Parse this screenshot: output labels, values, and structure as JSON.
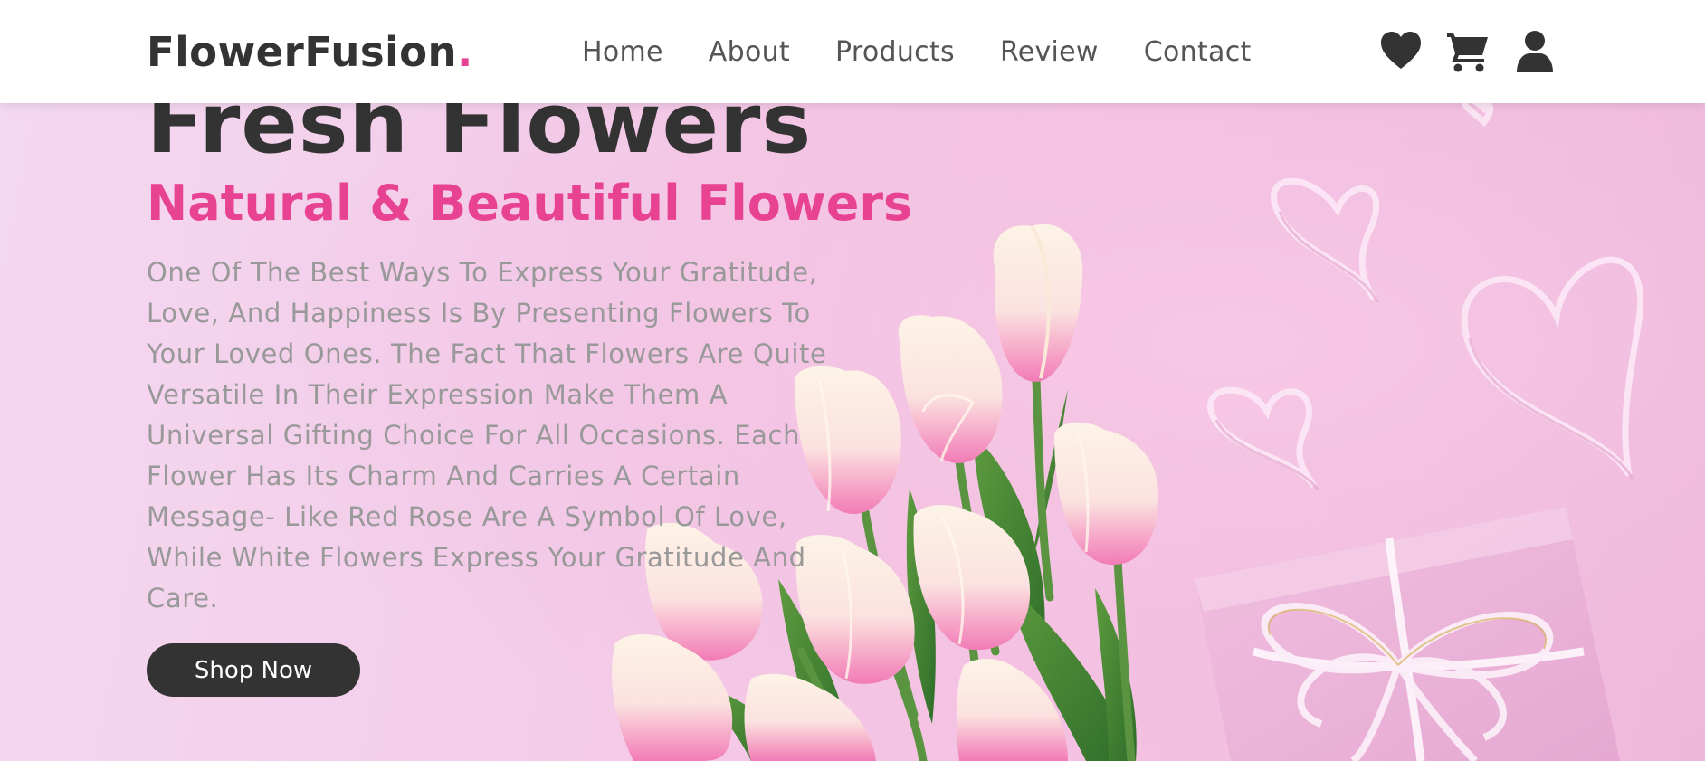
{
  "brand": {
    "name": "FlowerFusion",
    "dot": "."
  },
  "nav": {
    "links": [
      "Home",
      "About",
      "Products",
      "Review",
      "Contact"
    ],
    "icons": [
      "heart-icon",
      "shopping-cart-icon",
      "user-icon"
    ]
  },
  "hero": {
    "title": "Fresh Flowers",
    "subtitle": "Natural & Beautiful Flowers",
    "description": "One Of The Best Ways To Express Your Gratitude, Love, And Happiness Is By Presenting Flowers To Your Loved Ones. The Fact That Flowers Are Quite Versatile In Their Expression Make Them A Universal Gifting Choice For All Occasions. Each Flower Has Its Charm And Carries A Certain Message- Like Red Rose Are A Symbol Of Love, While White Flowers Express Your Gratitude And Care.",
    "cta": "Shop Now"
  },
  "colors": {
    "accent": "#e84393",
    "dark": "#333333",
    "muted": "#999999",
    "nav_text": "#555555",
    "navbar_bg": "#ffffff"
  }
}
